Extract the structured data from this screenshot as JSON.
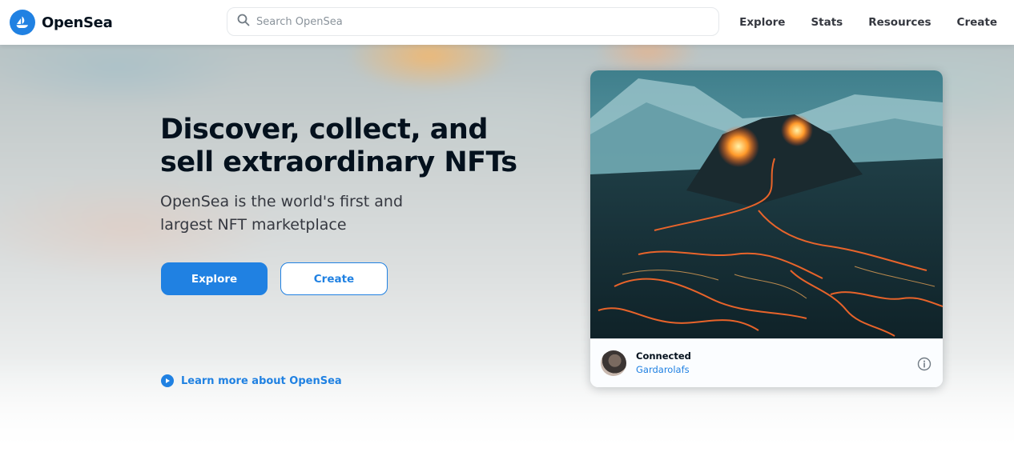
{
  "brand": {
    "name": "OpenSea",
    "color": "#2081e2"
  },
  "search": {
    "placeholder": "Search OpenSea",
    "value": ""
  },
  "nav": {
    "items": [
      {
        "label": "Explore"
      },
      {
        "label": "Stats"
      },
      {
        "label": "Resources"
      },
      {
        "label": "Create"
      }
    ]
  },
  "hero": {
    "headline": "Discover, collect, and sell extraordinary NFTs",
    "subheadline": "OpenSea is the world's first and largest NFT marketplace",
    "primary_button": "Explore",
    "secondary_button": "Create",
    "learn_more": "Learn more about OpenSea"
  },
  "featured": {
    "title": "Connected",
    "creator": "Gardarolafs",
    "info_icon": "info-icon"
  },
  "icons": {
    "logo": "opensea-logo-icon",
    "search": "search-icon",
    "learn_more": "play-circle-icon"
  }
}
